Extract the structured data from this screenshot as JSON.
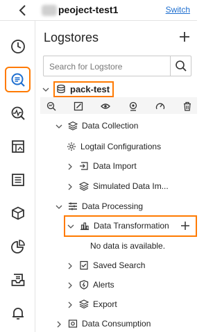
{
  "header": {
    "project_name": "peoject-test1",
    "switch_label": "Switch"
  },
  "nav": {
    "icons": [
      "clock-icon",
      "logstore-search-icon",
      "monitor-icon",
      "dashboard-icon",
      "list-icon",
      "package-icon",
      "pie-chart-icon",
      "inbox-icon",
      "bell-icon"
    ],
    "active": "logstore-search-icon"
  },
  "panel": {
    "title": "Logstores",
    "search_placeholder": "Search for Logstore"
  },
  "tree": {
    "logstore": "pack-test",
    "data_collection": "Data Collection",
    "logtail_configurations": "Logtail Configurations",
    "data_import": "Data Import",
    "simulated_data_import": "Simulated Data Im...",
    "data_processing": "Data Processing",
    "data_transformation": "Data Transformation",
    "no_data": "No data is available.",
    "saved_search": "Saved Search",
    "alerts": "Alerts",
    "export": "Export",
    "data_consumption": "Data Consumption"
  },
  "colors": {
    "highlight": "#ff7a00",
    "link": "#1e6fd0"
  }
}
